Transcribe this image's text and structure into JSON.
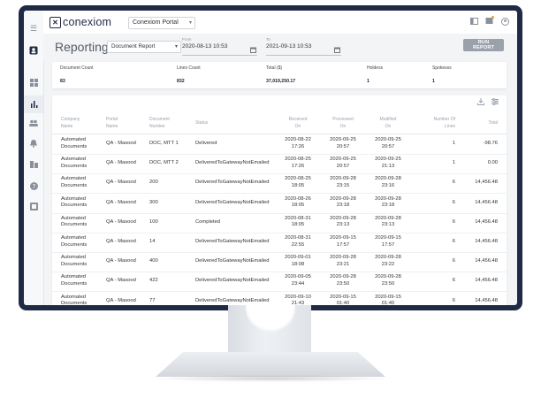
{
  "app": {
    "logo_text": "conexiom",
    "logo_mark": "✕",
    "portal_select": "Conexiom Portal"
  },
  "icons": {
    "rail": [
      "menu-icon",
      "profile-icon",
      "dashboard-icon",
      "reports-icon",
      "users-icon",
      "alerts-icon",
      "documents-icon",
      "help-icon",
      "gallery-icon"
    ],
    "top": [
      "panel-icon",
      "notifications-icon",
      "account-icon"
    ],
    "table_tools": [
      "download-icon",
      "settings-icon"
    ]
  },
  "reporting": {
    "title": "Reporting",
    "report_type": "Document Report",
    "from_label": "From",
    "from_value": "2020-08-13 10:53",
    "to_label": "To",
    "to_value": "2021-09-13 10:53",
    "run_button": "RUN REPORT"
  },
  "summary": {
    "headers": [
      "Document Count",
      "Lines Count",
      "Total ($)",
      "Holdess",
      "Spokesss"
    ],
    "values": [
      "83",
      "832",
      "37,019,250.17",
      "1",
      "1"
    ]
  },
  "table": {
    "columns": [
      {
        "line1": "Company",
        "line2": "Name"
      },
      {
        "line1": "Portal",
        "line2": "Name"
      },
      {
        "line1": "Document",
        "line2": "Number"
      },
      {
        "line1": "Status",
        "line2": ""
      },
      {
        "line1": "Received",
        "line2": "On"
      },
      {
        "line1": "Processed",
        "line2": "On"
      },
      {
        "line1": "Modified",
        "line2": "On"
      },
      {
        "line1": "Number Of",
        "line2": "Lines"
      },
      {
        "line1": "Total",
        "line2": ""
      }
    ],
    "rows": [
      {
        "company1": "Automated",
        "company2": "Documents",
        "portal": "QA - Masood",
        "doc": "DOC, MTT 1",
        "status": "Delivered",
        "rec1": "2020-08-22",
        "rec2": "17:26",
        "proc1": "2020-09-25",
        "proc2": "20:57",
        "mod1": "2020-09-25",
        "mod2": "20:57",
        "lines": "1",
        "total": "-98.76"
      },
      {
        "company1": "Automated",
        "company2": "Documents",
        "portal": "QA - Masood",
        "doc": "DOC, MTT 2",
        "status": "DeliveredToGatewayNotEmailed",
        "rec1": "2020-08-25",
        "rec2": "17:26",
        "proc1": "2020-09-25",
        "proc2": "20:57",
        "mod1": "2020-09-25",
        "mod2": "21:13",
        "lines": "1",
        "total": "0.00"
      },
      {
        "company1": "Automated",
        "company2": "Documents",
        "portal": "QA - Masood",
        "doc": "200",
        "status": "DeliveredToGatewayNotEmailed",
        "rec1": "2020-08-25",
        "rec2": "18:05",
        "proc1": "2020-09-28",
        "proc2": "23:15",
        "mod1": "2020-09-28",
        "mod2": "23:16",
        "lines": "6",
        "total": "14,456.48"
      },
      {
        "company1": "Automated",
        "company2": "Documents",
        "portal": "QA - Masood",
        "doc": "300",
        "status": "DeliveredToGatewayNotEmailed",
        "rec1": "2020-08-26",
        "rec2": "18:05",
        "proc1": "2020-09-28",
        "proc2": "23:18",
        "mod1": "2020-09-28",
        "mod2": "23:18",
        "lines": "6",
        "total": "14,456.48"
      },
      {
        "company1": "Automated",
        "company2": "Documents",
        "portal": "QA - Masood",
        "doc": "100",
        "status": "Completed",
        "rec1": "2020-08-31",
        "rec2": "18:05",
        "proc1": "2020-09-28",
        "proc2": "23:13",
        "mod1": "2020-09-28",
        "mod2": "23:13",
        "lines": "6",
        "total": "14,456.48"
      },
      {
        "company1": "Automated",
        "company2": "Documents",
        "portal": "QA - Masood",
        "doc": "14",
        "status": "DeliveredToGatewayNotEmailed",
        "rec1": "2020-08-31",
        "rec2": "22:55",
        "proc1": "2020-09-15",
        "proc2": "17:57",
        "mod1": "2020-09-15",
        "mod2": "17:57",
        "lines": "6",
        "total": "14,456.48"
      },
      {
        "company1": "Automated",
        "company2": "Documents",
        "portal": "QA - Masood",
        "doc": "400",
        "status": "DeliveredToGatewayNotEmailed",
        "rec1": "2020-09-01",
        "rec2": "18:08",
        "proc1": "2020-09-28",
        "proc2": "23:21",
        "mod1": "2020-09-28",
        "mod2": "23:22",
        "lines": "6",
        "total": "14,456.48"
      },
      {
        "company1": "Automated",
        "company2": "Documents",
        "portal": "QA - Masood",
        "doc": "422",
        "status": "DeliveredToGatewayNotEmailed",
        "rec1": "2020-09-05",
        "rec2": "23:44",
        "proc1": "2020-09-28",
        "proc2": "23:50",
        "mod1": "2020-09-28",
        "mod2": "23:50",
        "lines": "6",
        "total": "14,456.48"
      },
      {
        "company1": "Automated",
        "company2": "Documents",
        "portal": "QA - Masood",
        "doc": "77",
        "status": "DeliveredToGatewayNotEmailed",
        "rec1": "2020-09-10",
        "rec2": "21:43",
        "proc1": "2020-09-15",
        "proc2": "01:40",
        "mod1": "2020-09-15",
        "mod2": "01:40",
        "lines": "6",
        "total": "14,456.48"
      }
    ]
  },
  "colors": {
    "bezel": "#1f2a44",
    "accent": "#1f2a44",
    "button": "#9aa1ab"
  }
}
